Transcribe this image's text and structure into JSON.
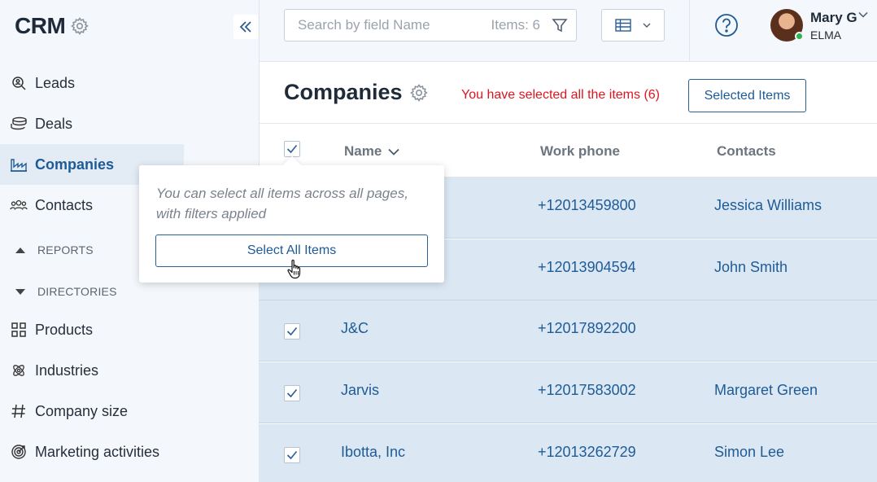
{
  "sidebar": {
    "brand": "CRM",
    "items": [
      {
        "label": "Leads",
        "icon": "search-person-icon"
      },
      {
        "label": "Deals",
        "icon": "coins-icon"
      },
      {
        "label": "Companies",
        "icon": "factory-icon",
        "active": true
      },
      {
        "label": "Contacts",
        "icon": "people-icon"
      }
    ],
    "sections": {
      "reports": "REPORTS",
      "directories": "DIRECTORIES"
    },
    "directories": [
      {
        "label": "Products",
        "icon": "grid-icon"
      },
      {
        "label": "Industries",
        "icon": "atom-icon"
      },
      {
        "label": "Company size",
        "icon": "hash-icon"
      },
      {
        "label": "Marketing activities",
        "icon": "target-icon"
      }
    ]
  },
  "topbar": {
    "search_placeholder": "Search by field Name",
    "items_count": "Items: 6",
    "user": {
      "name": "Mary G",
      "org": "ELMA"
    }
  },
  "main": {
    "title": "Companies",
    "selection_message": "You have selected all the items (6)",
    "selected_items_button": "Selected Items",
    "columns": {
      "name": "Name",
      "phone": "Work phone",
      "contacts": "Contacts"
    },
    "rows": [
      {
        "name": "",
        "phone": "+12013459800",
        "contact": "Jessica Williams",
        "checked": true
      },
      {
        "name": "",
        "phone": "+12013904594",
        "contact": "John Smith",
        "checked": true
      },
      {
        "name": "J&C",
        "phone": "+12017892200",
        "contact": "",
        "checked": true
      },
      {
        "name": "Jarvis",
        "phone": "+12017583002",
        "contact": "Margaret Green",
        "checked": true
      },
      {
        "name": "Ibotta, Inc",
        "phone": "+12013262729",
        "contact": "Simon Lee",
        "checked": true
      }
    ]
  },
  "popover": {
    "text": "You can select all items across all pages, with filters applied",
    "button": "Select All Items"
  },
  "colors": {
    "accent": "#1e5b96",
    "selected_row": "#dbe8f4",
    "alert": "#e0141e"
  }
}
